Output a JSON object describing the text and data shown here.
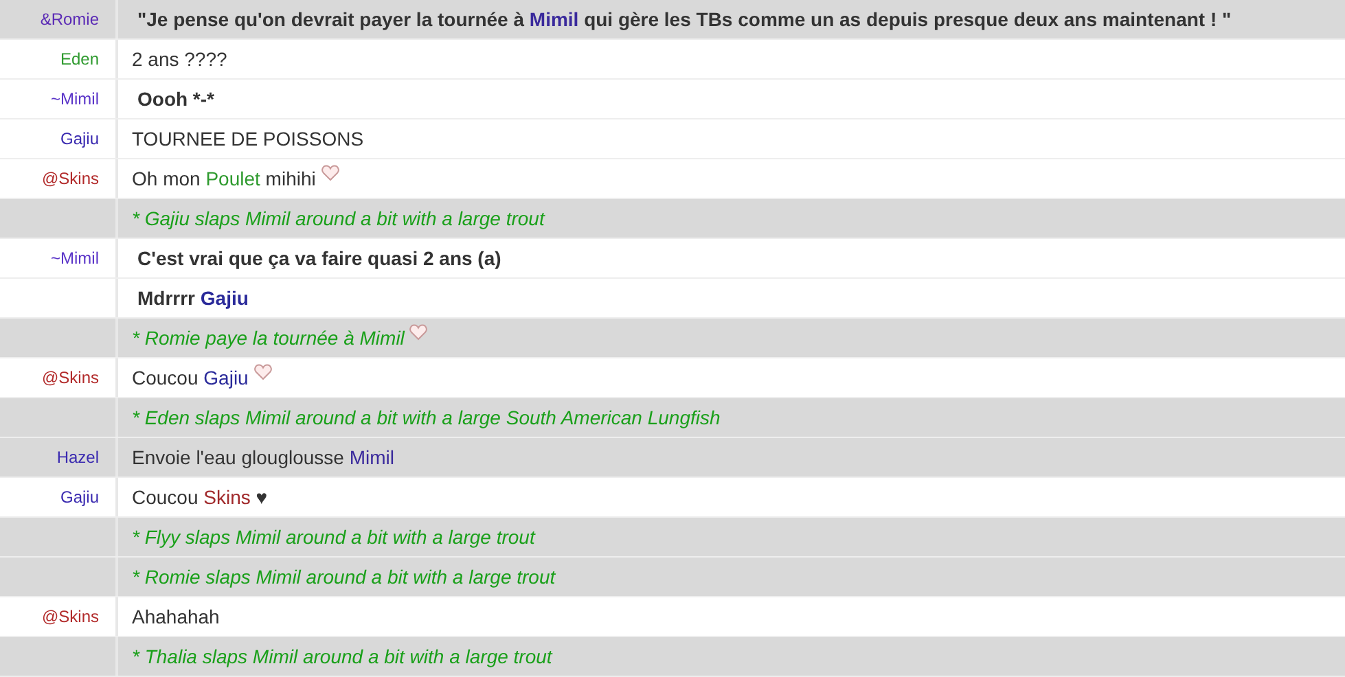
{
  "rows": [
    {
      "nick": "&Romie",
      "color": "#5b2bb5",
      "kind": "message",
      "highlighted": true,
      "bold": true,
      "parts": [
        {
          "text": "\"Je pense qu'on devrait payer la tournée à "
        },
        {
          "text": "Mimil",
          "color": "#3a2a9c"
        },
        {
          "text": " qui gère les TBs comme un as depuis presque deux ans maintenant ! \""
        }
      ]
    },
    {
      "nick": "Eden",
      "color": "#2e9a2e",
      "kind": "message",
      "highlighted": false,
      "bold": false,
      "parts": [
        {
          "text": "2 ans ????"
        }
      ]
    },
    {
      "nick": "~Mimil",
      "color": "#5a34c8",
      "kind": "message",
      "highlighted": false,
      "bold": true,
      "parts": [
        {
          "text": "Oooh *-*"
        }
      ]
    },
    {
      "nick": "Gajiu",
      "color": "#3a2ab0",
      "kind": "message",
      "highlighted": false,
      "bold": false,
      "parts": [
        {
          "text": "TOURNEE DE POISSONS"
        }
      ]
    },
    {
      "nick": "@Skins",
      "color": "#b22a2a",
      "kind": "message",
      "highlighted": false,
      "bold": false,
      "emoticon": true,
      "parts": [
        {
          "text": "Oh mon "
        },
        {
          "text": "Poulet",
          "color": "#2e9a2e"
        },
        {
          "text": " mihihi"
        }
      ]
    },
    {
      "kind": "action",
      "highlighted": true,
      "parts": [
        {
          "text": "* Gajiu slaps Mimil around a bit with a large trout"
        }
      ]
    },
    {
      "nick": "~Mimil",
      "color": "#5a34c8",
      "kind": "message",
      "highlighted": false,
      "bold": true,
      "parts": [
        {
          "text": "C'est vrai que ça va faire quasi 2 ans (a)"
        }
      ]
    },
    {
      "kind": "message",
      "highlighted": false,
      "bold": true,
      "parts": [
        {
          "text": "Mdrrrr "
        },
        {
          "text": "Gajiu",
          "color": "#2a2a9a"
        }
      ]
    },
    {
      "kind": "action",
      "highlighted": true,
      "emoticon": true,
      "parts": [
        {
          "text": "* Romie paye la tournée à Mimil"
        }
      ]
    },
    {
      "nick": "@Skins",
      "color": "#b22a2a",
      "kind": "message",
      "highlighted": false,
      "bold": false,
      "emoticon": true,
      "parts": [
        {
          "text": "Coucou "
        },
        {
          "text": "Gajiu",
          "color": "#2a2a9a"
        }
      ]
    },
    {
      "kind": "action",
      "highlighted": true,
      "parts": [
        {
          "text": "* Eden slaps Mimil around a bit with a large South American Lungfish"
        }
      ]
    },
    {
      "nick": "Hazel",
      "color": "#3a2ab0",
      "kind": "message",
      "highlighted": true,
      "bold": false,
      "parts": [
        {
          "text": "Envoie l'eau glouglousse "
        },
        {
          "text": "Mimil",
          "color": "#3a2a9c"
        }
      ]
    },
    {
      "nick": "Gajiu",
      "color": "#3a2ab0",
      "kind": "message",
      "highlighted": false,
      "bold": false,
      "parts": [
        {
          "text": "Coucou "
        },
        {
          "text": "Skins",
          "color": "#a0282a"
        },
        {
          "text": " ♥"
        }
      ]
    },
    {
      "kind": "action",
      "highlighted": true,
      "parts": [
        {
          "text": "* Flyy slaps Mimil around a bit with a large trout"
        }
      ]
    },
    {
      "kind": "action",
      "highlighted": true,
      "parts": [
        {
          "text": "* Romie slaps Mimil around a bit with a large trout"
        }
      ]
    },
    {
      "nick": "@Skins",
      "color": "#b22a2a",
      "kind": "message",
      "highlighted": false,
      "bold": false,
      "parts": [
        {
          "text": "Ahahahah"
        }
      ]
    },
    {
      "kind": "action",
      "highlighted": true,
      "parts": [
        {
          "text": "* Thalia slaps Mimil around a bit with a large trout"
        }
      ]
    }
  ]
}
